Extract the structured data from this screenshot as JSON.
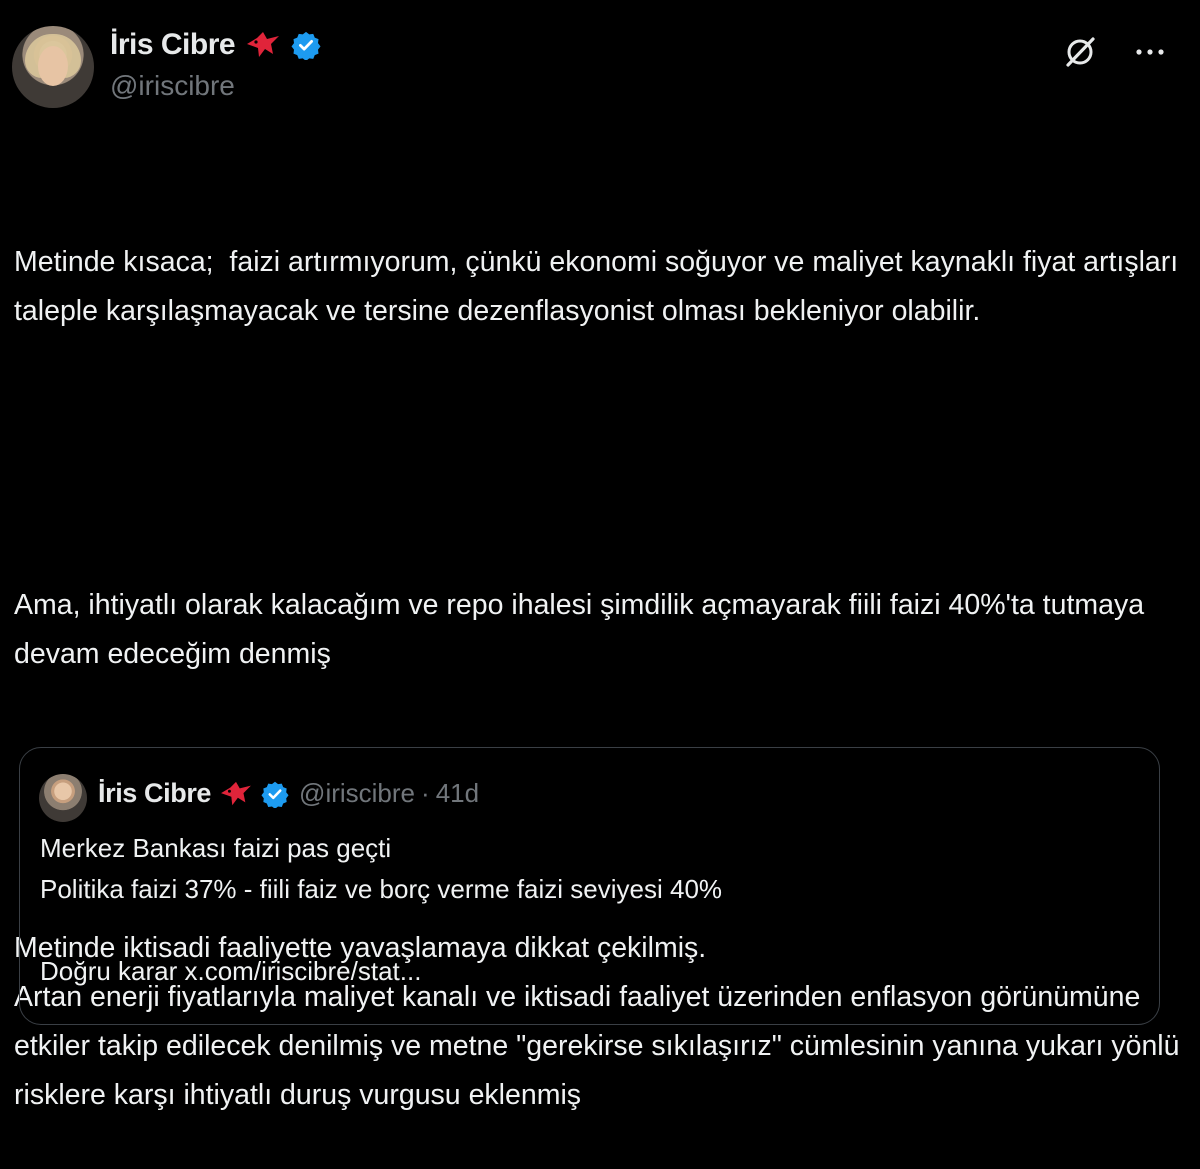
{
  "author": {
    "name": "İris Cibre",
    "handle": "@iriscibre"
  },
  "header_icons": [
    "grok-icon",
    "more-icon"
  ],
  "tweet": {
    "paragraphs": [
      "Metinde kısaca;  faizi artırmıyorum, çünkü ekonomi soğuyor ve maliyet kaynaklı fiyat artışları taleple karşılaşmayacak ve tersine dezenflasyonist olması bekleniyor olabilir.",
      "Ama, ihtiyatlı olarak kalacağım ve repo ihalesi şimdilik açmayarak fiili faizi 40%'ta tutmaya devam edeceğim denmiş",
      "Metinde iktisadi faaliyette yavaşlamaya dikkat çekilmiş.\nArtan enerji fiyatlarıyla maliyet kanalı ve iktisadi faaliyet üzerinden enflasyon görünümüne etkiler takip edilecek denilmiş ve metne \"gerekirse sıkılaşırız\" cümlesinin yanına yukarı yönlü risklere karşı ihtiyatlı duruş vurgusu eklenmiş"
    ]
  },
  "quote": {
    "name": "İris Cibre",
    "handle": "@iriscibre",
    "separator": "·",
    "time": "41d",
    "text": "Merkez Bankası faizi pas geçti\nPolitika faizi 37% - fiili faiz ve borç verme faizi seviyesi 40%\n\nDoğru karar x.com/iriscibre/stat..."
  },
  "colors": {
    "background": "#000000",
    "text": "#e7e9ea",
    "secondary": "#71767b",
    "verified": "#1d9bf0",
    "bird": "#e0243a",
    "border": "#3a3f45"
  }
}
